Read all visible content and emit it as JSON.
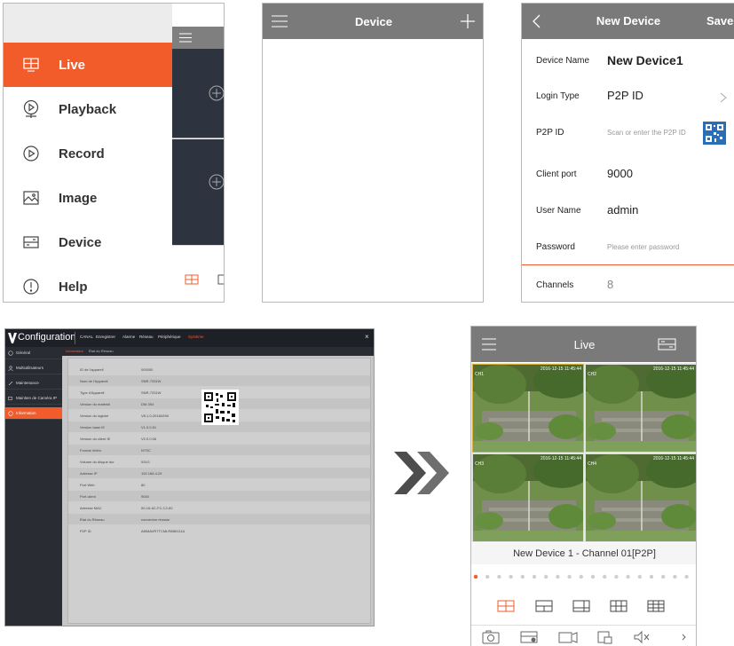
{
  "side_menu": {
    "items": [
      {
        "label": "Live",
        "icon": "monitor-icon",
        "active": true
      },
      {
        "label": "Playback",
        "icon": "playback-icon",
        "active": false
      },
      {
        "label": "Record",
        "icon": "play-circle-icon",
        "active": false
      },
      {
        "label": "Image",
        "icon": "image-icon",
        "active": false
      },
      {
        "label": "Device",
        "icon": "dvr-device-icon",
        "active": false
      },
      {
        "label": "Help",
        "icon": "help-icon",
        "active": false
      }
    ]
  },
  "device_list": {
    "title": "Device"
  },
  "new_device": {
    "title": "New Device",
    "save_label": "Save",
    "fields": {
      "device_name": {
        "label": "Device Name",
        "value": "New Device1"
      },
      "login_type": {
        "label": "Login Type",
        "value": "P2P ID"
      },
      "p2p_id": {
        "label": "P2P ID",
        "placeholder": "Scan or enter the P2P ID"
      },
      "client_port": {
        "label": "Client port",
        "value": "9000"
      },
      "user_name": {
        "label": "User Name",
        "value": "admin"
      },
      "password": {
        "label": "Password",
        "placeholder": "Please enter password"
      },
      "channels": {
        "label": "Channels",
        "value": "8"
      }
    }
  },
  "configuration": {
    "title": "Configuration",
    "nav": [
      "CANAL",
      "Enregistrer",
      "Alarme",
      "Réseau",
      "Périphérique",
      "Système"
    ],
    "active_nav": "Système",
    "sidebar": [
      "Général",
      "Multiutilisateurs",
      "Maintenance",
      "Maintien de Caméra IP",
      "Information"
    ],
    "active_sidebar": "Information",
    "tabs": [
      "Information",
      "État du Réseau"
    ],
    "active_tab": "Information",
    "info_rows": [
      {
        "label": "ID de l'appareil",
        "value": "000000"
      },
      {
        "label": "Nom de l'Appareil",
        "value": "SNR-7331W"
      },
      {
        "label": "Type d'Appareil",
        "value": "SNR-7331W"
      },
      {
        "label": "Version du matériel",
        "value": "DM-354"
      },
      {
        "label": "Version du logiciel",
        "value": "V8.1.0-20160298"
      },
      {
        "label": "Version base IE",
        "value": "V1.0.0.51"
      },
      {
        "label": "Version du client IE",
        "value": "V2.0.0.06"
      },
      {
        "label": "Format Vidéo",
        "value": "NTSC"
      },
      {
        "label": "Volume du disque dur",
        "value": "931G"
      },
      {
        "label": "Adresse IP",
        "value": "192.168.4.29"
      },
      {
        "label": "Port Web",
        "value": "80"
      },
      {
        "label": "Port client",
        "value": "9000"
      },
      {
        "label": "Adresse MAC",
        "value": "00-16-6C-FC-C2-82"
      },
      {
        "label": "État du Réseau",
        "value": "connexion réussie"
      },
      {
        "label": "P2P ID",
        "value": "A808AVR7TCMLR6B6111A"
      }
    ]
  },
  "live": {
    "title": "Live",
    "caption": "New Device 1 - Channel 01[P2P]",
    "cameras": [
      {
        "timestamp": "2016-12-15 11:45:44",
        "channel": "CH1"
      },
      {
        "timestamp": "2016-12-15 11:45:44",
        "channel": "CH2"
      },
      {
        "timestamp": "2016-12-15 11:45:44",
        "channel": "CH3"
      },
      {
        "timestamp": "2016-12-15 11:45:44",
        "channel": "CH4"
      }
    ]
  },
  "colors": {
    "accent": "#f25c2b",
    "header_gray": "#7a7a7a",
    "dark_panel": "#2a2c33"
  }
}
